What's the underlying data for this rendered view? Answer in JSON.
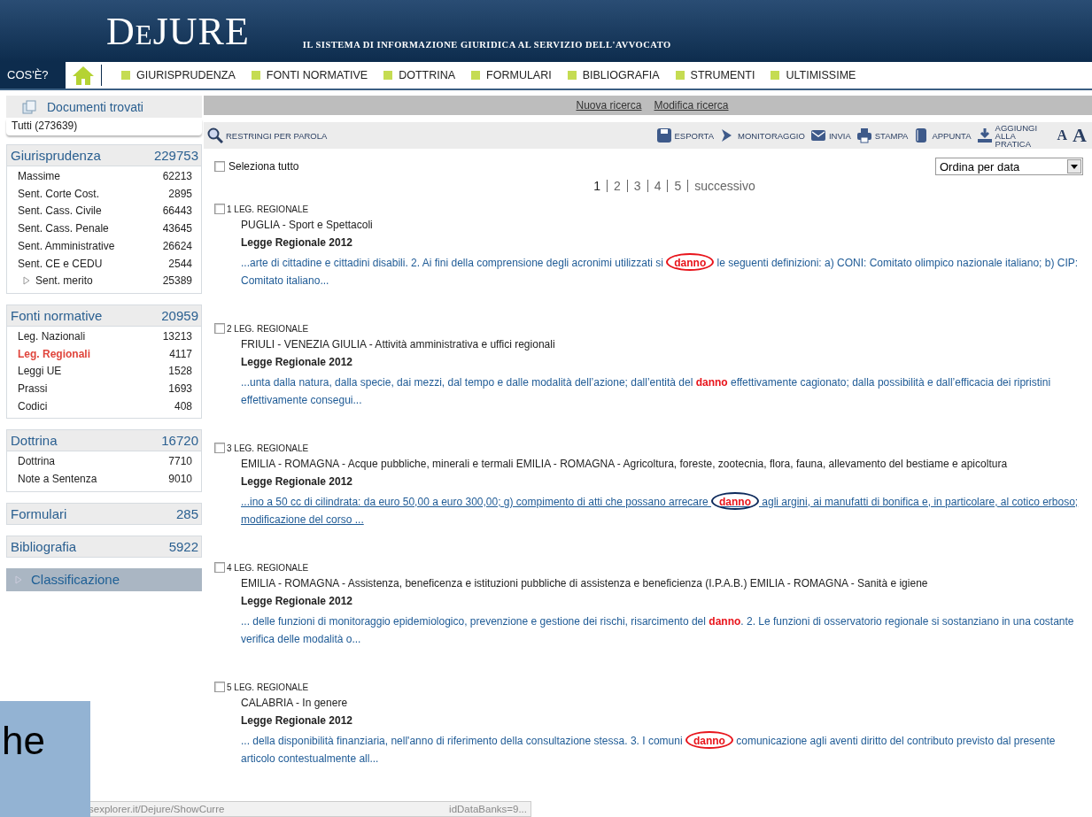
{
  "header": {
    "logo": "DeJURE",
    "tagline": "IL SISTEMA DI INFORMAZIONE GIURIDICA AL SERVIZIO DELL'AVVOCATO"
  },
  "nav": {
    "about": "COS'È?",
    "items": [
      "GIURISPRUDENZA",
      "FONTI NORMATIVE",
      "DOTTRINA",
      "FORMULARI",
      "BIBLIOGRAFIA",
      "STRUMENTI",
      "ULTIMISSIME"
    ]
  },
  "sidebar": {
    "title": "Documenti trovati",
    "all_tab": "Tutti (273639)",
    "groups": [
      {
        "label": "Giurisprudenza",
        "count": "229753",
        "items": [
          {
            "label": "Massime",
            "count": "62213",
            "selected": false
          },
          {
            "label": "Sent. Corte Cost.",
            "count": "2895",
            "selected": false
          },
          {
            "label": "Sent. Cass. Civile",
            "count": "66443",
            "selected": false
          },
          {
            "label": "Sent. Cass. Penale",
            "count": "43645",
            "selected": false
          },
          {
            "label": "Sent. Amministrative",
            "count": "26624",
            "selected": false
          },
          {
            "label": "Sent. CE e CEDU",
            "count": "2544",
            "selected": false
          },
          {
            "label": "Sent. merito",
            "count": "25389",
            "selected": false,
            "expandable": true
          }
        ]
      },
      {
        "label": "Fonti normative",
        "count": "20959",
        "items": [
          {
            "label": "Leg. Nazionali",
            "count": "13213",
            "selected": false
          },
          {
            "label": "Leg. Regionali",
            "count": "4117",
            "selected": true
          },
          {
            "label": "Leggi UE",
            "count": "1528",
            "selected": false
          },
          {
            "label": "Prassi",
            "count": "1693",
            "selected": false
          },
          {
            "label": "Codici",
            "count": "408",
            "selected": false
          }
        ]
      },
      {
        "label": "Dottrina",
        "count": "16720",
        "items": [
          {
            "label": "Dottrina",
            "count": "7710",
            "selected": false
          },
          {
            "label": "Note a Sentenza",
            "count": "9010",
            "selected": false
          }
        ]
      },
      {
        "label": "Formulari",
        "count": "285"
      },
      {
        "label": "Bibliografia",
        "count": "5922"
      }
    ],
    "classification": {
      "label": "Classificazione",
      "expanded": false
    }
  },
  "search_links": [
    "Nuova ricerca",
    "Modifica ricerca"
  ],
  "toolbar": {
    "filter": "RESTRINGI PER PAROLA",
    "actions": [
      {
        "kind": "export",
        "label": "ESPORTA"
      },
      {
        "kind": "monitor",
        "label": "MONITORAGGIO"
      },
      {
        "kind": "send",
        "label": "INVIA"
      },
      {
        "kind": "print",
        "label": "STAMPA"
      },
      {
        "kind": "note",
        "label": "APPUNTA"
      },
      {
        "kind": "add",
        "label": "AGGIUNGI ALLA PRATICA"
      }
    ],
    "font_small": "A",
    "font_large": "A"
  },
  "select_all": {
    "label": "Seleziona tutto",
    "checked": false
  },
  "sort": {
    "value": "Ordina per data"
  },
  "pagination": {
    "pages": [
      {
        "label": "1",
        "selected": true
      },
      {
        "label": "2",
        "selected": false
      },
      {
        "label": "3",
        "selected": false
      },
      {
        "label": "4",
        "selected": false
      },
      {
        "label": "5",
        "selected": false
      }
    ],
    "next": "successivo"
  },
  "results": [
    {
      "type": "1 LEG. REGIONALE",
      "checked": false,
      "title": "PUGLIA - Sport e Spettacoli",
      "subtitle": "Legge Regionale 2012",
      "snippet": "...arte di cittadine e cittadini disabili. 2. Ai fini della comprensione degli acronimi utilizzati si **danno** le seguenti definizioni: a) CONI: Comitato olimpico nazionale italiano; b) CIP: Comitato italiano...",
      "underlined": false,
      "ring": {
        "color": "#e8141b"
      }
    },
    {
      "type": "2 LEG. REGIONALE",
      "checked": false,
      "title": "FRIULI - VENEZIA GIULIA - Attività amministrativa e uffici regionali",
      "subtitle": "Legge Regionale 2012",
      "snippet": "...unta dalla natura, dalla specie, dai mezzi, dal tempo e dalle modalità dell’azione; dall’entità del **danno** effettivamente cagionato; dalla possibilità e dall’efficacia dei ripristini effettivamente consegui...",
      "underlined": false
    },
    {
      "type": "3 LEG. REGIONALE",
      "checked": false,
      "title": "EMILIA - ROMAGNA - Acque pubbliche, minerali e termali EMILIA - ROMAGNA - Agricoltura, foreste, zootecnia, flora, fauna, allevamento del bestiame e apicoltura",
      "subtitle": "Legge Regionale 2012",
      "snippet": "...ino a 50 cc di cilindrata: da euro 50,00 a euro 300,00; g) compimento di atti che possano arrecare **danno** agli argini, ai manufatti di bonifica e, in particolare, al cotico erboso; modificazione del corso ...",
      "underlined": true,
      "ring": {
        "color": "#0d2a5c"
      }
    },
    {
      "type": "4 LEG. REGIONALE",
      "checked": false,
      "title": "EMILIA - ROMAGNA - Assistenza, beneficenza e istituzioni pubbliche di assistenza e beneficienza (I.P.A.B.) EMILIA - ROMAGNA - Sanità e igiene",
      "subtitle": "Legge Regionale 2012",
      "snippet": "... delle funzioni di monitoraggio epidemiologico, prevenzione e gestione dei rischi, risarcimento del **danno**. 2. Le funzioni di osservatorio regionale si sostanziano in una costante verifica delle modalità o...",
      "underlined": false
    },
    {
      "type": "5 LEG. REGIONALE",
      "checked": false,
      "title": "CALABRIA - In genere",
      "subtitle": "Legge Regionale 2012",
      "snippet": "... della disponibilità finanziaria, nell'anno di riferimento della consultazione stessa. 3. I comuni **danno** comunicazione agli aventi diritto del contributo previsto dal presente articolo contestualmente all...",
      "underlined": false,
      "ring": {
        "color": "#e8141b"
      }
    }
  ],
  "status_bar": {
    "url_start": "sexplorer.it/Dejure/ShowCurre",
    "url_end": "idDataBanks=9..."
  },
  "slide_overlay": {
    "text": "he"
  }
}
